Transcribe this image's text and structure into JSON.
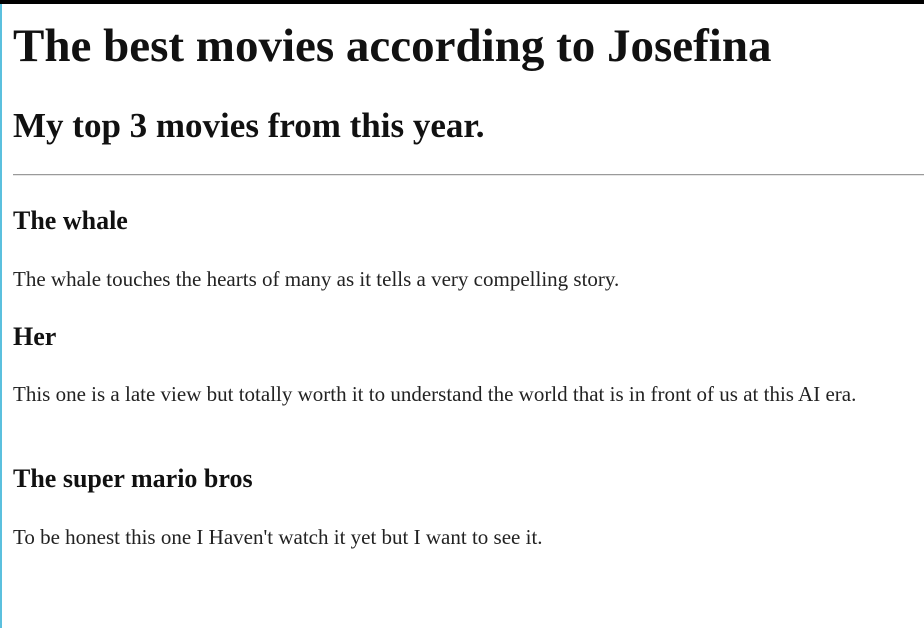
{
  "page": {
    "title": "The best movies according to Josefina",
    "subtitle": "My top 3 movies from this year."
  },
  "movies": [
    {
      "title": "The whale",
      "description": "The whale touches the hearts of many as it tells a very compelling story."
    },
    {
      "title": "Her",
      "description": "This one is a late view but totally worth it to understand the world that is in front of us at this AI era."
    },
    {
      "title": "The super mario bros",
      "description": "To be honest this one I Haven't watch it yet but I want to see it."
    }
  ],
  "colors": {
    "top_bar": "#000000",
    "left_edge": "#5bc0de",
    "text": "#111111",
    "divider": "#9a9a9a"
  }
}
